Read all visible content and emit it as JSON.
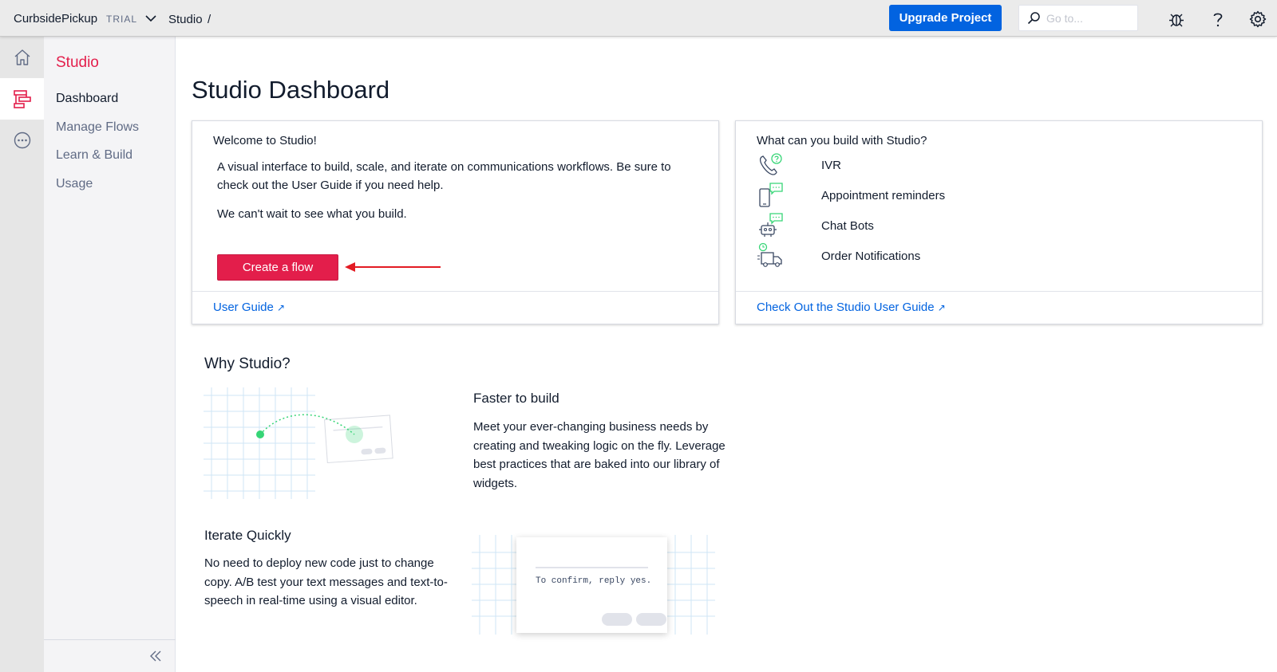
{
  "topbar": {
    "project_name": "CurbsidePickup",
    "trial_label": "TRIAL",
    "breadcrumb": "Studio",
    "breadcrumb_sep": "/",
    "upgrade_label": "Upgrade Project",
    "search_placeholder": "Go to...",
    "icons": [
      "chevron-down-icon",
      "search-icon",
      "bug-icon",
      "help-icon",
      "gear-icon"
    ]
  },
  "rail": {
    "items": [
      {
        "icon": "home-icon"
      },
      {
        "icon": "studio-icon",
        "active": true
      },
      {
        "icon": "more-icon"
      }
    ]
  },
  "sidebar": {
    "title": "Studio",
    "items": [
      {
        "label": "Dashboard",
        "active": true
      },
      {
        "label": "Manage Flows"
      },
      {
        "label": "Learn & Build"
      },
      {
        "label": "Usage"
      }
    ],
    "collapse_icon": "double-chevron-left-icon"
  },
  "page": {
    "title": "Studio Dashboard"
  },
  "welcome_card": {
    "heading": "Welcome to Studio!",
    "description": "A visual interface to build, scale, and iterate on communications workflows. Be sure to check out the User Guide if you need help.",
    "description2": "We can't wait to see what you build.",
    "button_label": "Create a flow",
    "link_label": "User Guide",
    "link_icon": "↗"
  },
  "build_card": {
    "heading": "What can you build with Studio?",
    "items": [
      {
        "label": "IVR",
        "icon": "phone-question-icon"
      },
      {
        "label": "Appointment reminders",
        "icon": "mobile-message-icon"
      },
      {
        "label": "Chat Bots",
        "icon": "bot-message-icon"
      },
      {
        "label": "Order Notifications",
        "icon": "delivery-truck-icon"
      }
    ],
    "link_label": "Check Out the Studio User Guide",
    "link_icon": "↗"
  },
  "why": {
    "title": "Why Studio?",
    "features": [
      {
        "title": "Faster to build",
        "text": "Meet your ever-changing business needs by creating and tweaking logic on the fly. Leverage best practices that are baked into our library of widgets."
      },
      {
        "title": "Iterate Quickly",
        "text": "No need to deploy new code just to change copy. A/B test your text messages and text-to-speech in real-time using a visual editor."
      }
    ],
    "mock_text": "To confirm, reply yes."
  },
  "colors": {
    "brand_red": "#e31e4b",
    "primary_blue": "#0263e0",
    "accent_green": "#36d576",
    "annotation_arrow": "#e31b23"
  }
}
